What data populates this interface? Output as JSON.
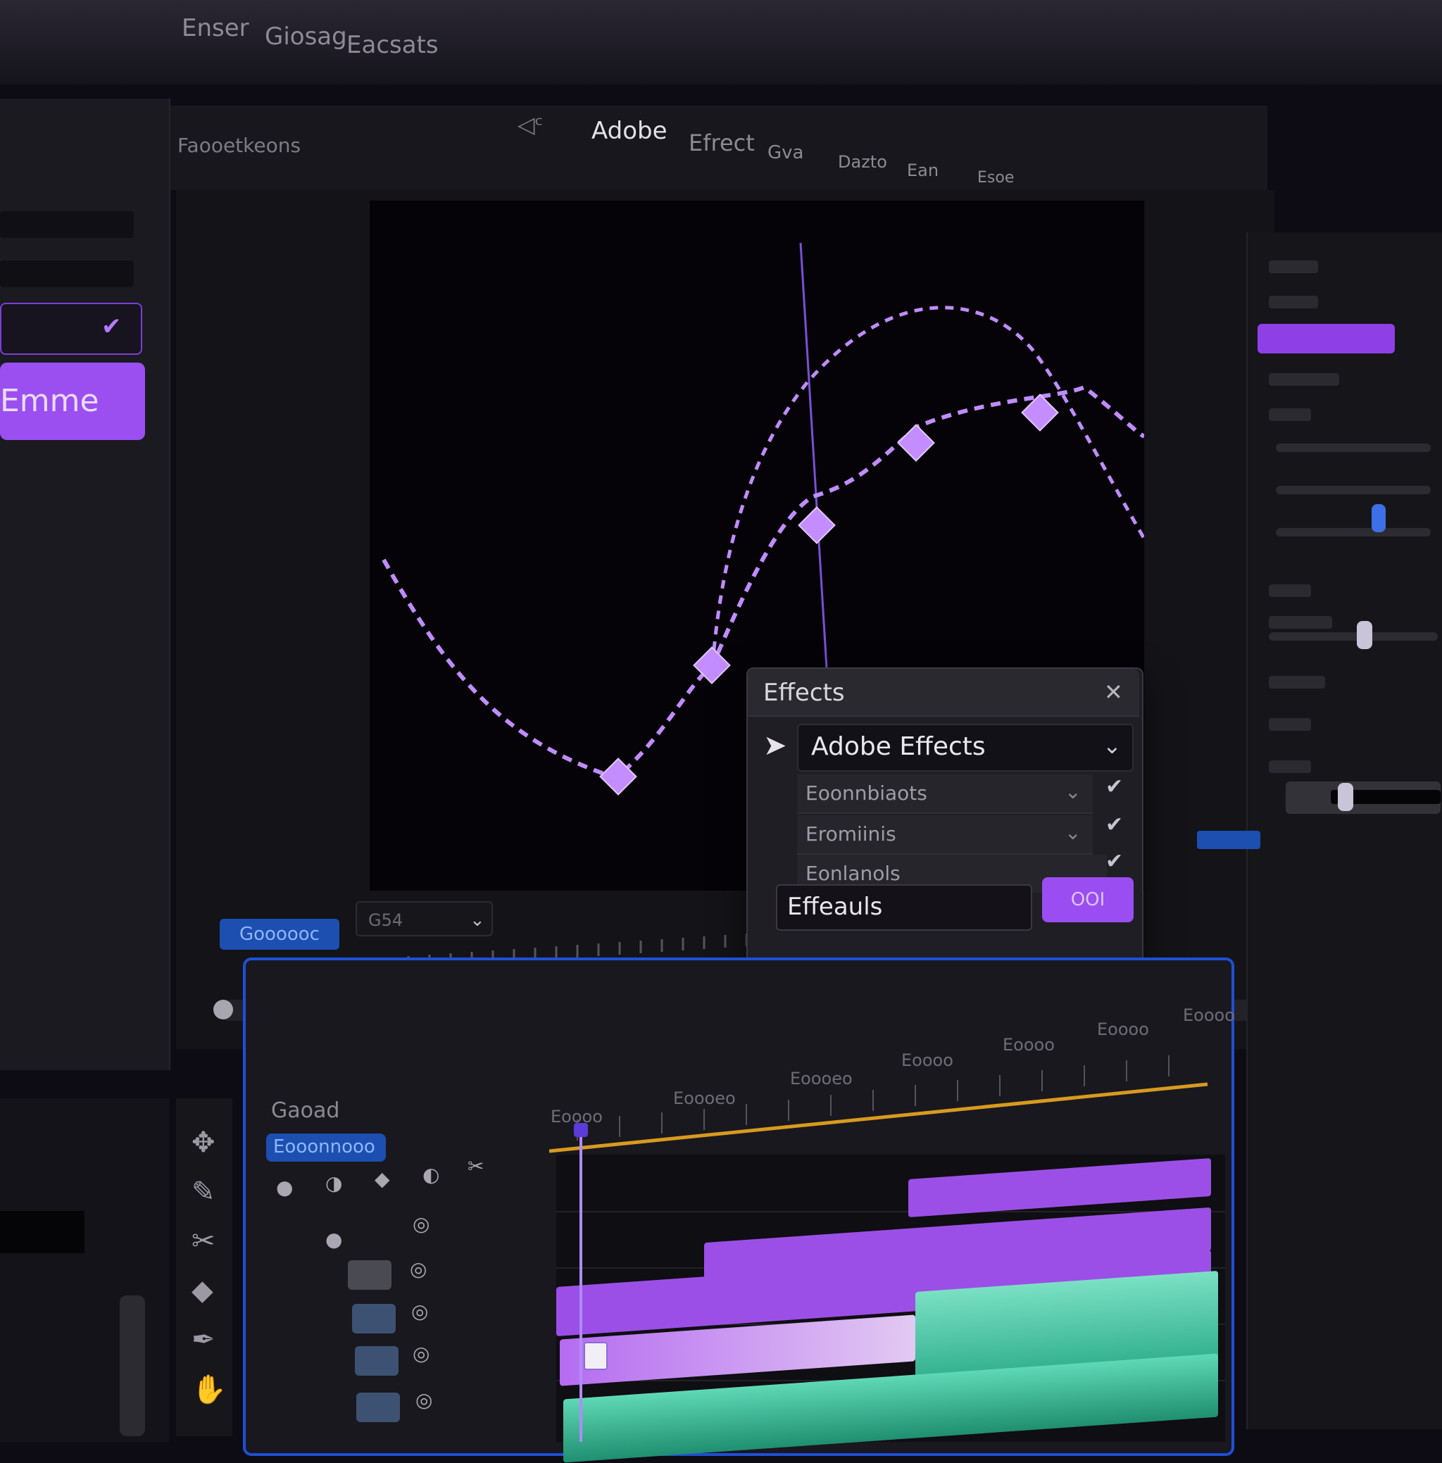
{
  "menu": {
    "items": [
      "Enser",
      "Giosag",
      "Eacsats"
    ]
  },
  "toolbar": {
    "items": [
      "Adobe",
      "Efrect",
      "Gva",
      "Dazto",
      "Ean",
      "Esoe"
    ],
    "logo_text": "Faooetkeons"
  },
  "left_panel": {
    "purple_label": "Emme"
  },
  "viewer": {
    "zoom_badge": "Goooooc",
    "res_select": "G54"
  },
  "effects_panel": {
    "title": "Effects",
    "close": "✕",
    "select_label": "Adobe Effects",
    "rows": [
      {
        "label": "Eoonnbiaots"
      },
      {
        "label": "Eromiinis"
      },
      {
        "label": "Eonlanols"
      }
    ],
    "search_value": "Effeauls",
    "ok_label": "OOI"
  },
  "timeline": {
    "header_label": "Gaoad",
    "badge": "Eooonnooo",
    "ruler_labels": [
      "Eoooo",
      "Eoooeo",
      "Eoooeo",
      "Eoooo",
      "Eoooo",
      "Eoooo",
      "Eoooo"
    ]
  },
  "colors": {
    "accent_purple": "#9b4ff0",
    "accent_blue": "#1f4fd6",
    "curve_purple": "#c08cff",
    "clip_purple": "#9c4fe6",
    "clip_teal": "#39c9a0",
    "ruler_gold": "#d89a1f"
  },
  "icons": {
    "close": "close-icon",
    "select_arrow": "pointer-arrow-icon",
    "chevron": "chevron-down-icon",
    "check": "check-icon"
  }
}
